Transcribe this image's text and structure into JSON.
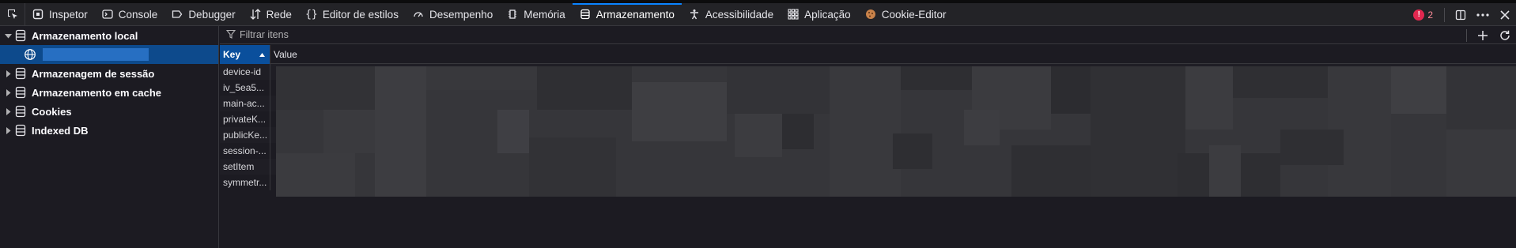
{
  "toolbar": {
    "tabs": [
      {
        "label": "Inspetor",
        "icon": "inspector-icon"
      },
      {
        "label": "Console",
        "icon": "console-icon"
      },
      {
        "label": "Debugger",
        "icon": "debugger-icon"
      },
      {
        "label": "Rede",
        "icon": "network-icon"
      },
      {
        "label": "Editor de estilos",
        "icon": "style-editor-icon"
      },
      {
        "label": "Desempenho",
        "icon": "performance-icon"
      },
      {
        "label": "Memória",
        "icon": "memory-icon"
      },
      {
        "label": "Armazenamento",
        "icon": "storage-icon",
        "active": true
      },
      {
        "label": "Acessibilidade",
        "icon": "accessibility-icon"
      },
      {
        "label": "Aplicação",
        "icon": "application-icon"
      },
      {
        "label": "Cookie-Editor",
        "icon": "cookie-editor-icon"
      }
    ],
    "error_count": "2"
  },
  "tree": {
    "local_storage": "Armazenamento local",
    "session_storage": "Armazenagem de sessão",
    "cache_storage": "Armazenamento em cache",
    "cookies": "Cookies",
    "indexed_db": "Indexed DB"
  },
  "filter": {
    "placeholder": "Filtrar itens"
  },
  "table": {
    "headers": {
      "key": "Key",
      "value": "Value"
    },
    "rows": [
      {
        "key": "device-id"
      },
      {
        "key": "iv_5ea5..."
      },
      {
        "key": "main-ac..."
      },
      {
        "key": "privateK..."
      },
      {
        "key": "publicKe..."
      },
      {
        "key": "session-..."
      },
      {
        "key": "setItem"
      },
      {
        "key": "symmetr..."
      }
    ]
  },
  "colors": {
    "accent": "#0a84ff",
    "selection": "#0d4a8c",
    "background": "#1c1b22"
  }
}
